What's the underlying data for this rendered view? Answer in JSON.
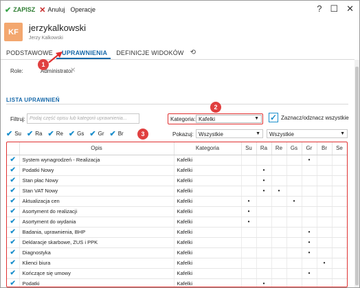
{
  "toolbar": {
    "save_label": "ZAPISZ",
    "cancel_label": "Anuluj",
    "operations_label": "Operacje",
    "help_glyph": "?",
    "maximize_glyph": "☐",
    "close_glyph": "✕"
  },
  "header": {
    "avatar_initials": "KF",
    "title": "jerzykalkowski",
    "subtitle": "Jerzy Kalkowski"
  },
  "tabs": [
    {
      "label": "PODSTAWOWE"
    },
    {
      "label": "UPRAWNIENIA"
    },
    {
      "label": "DEFINICJE WIDOKÓW"
    }
  ],
  "role": {
    "label": "Role:",
    "value": "Administrator"
  },
  "section": {
    "title": "LISTA UPRAWNIEŃ"
  },
  "filter": {
    "label": "Filtruj:",
    "placeholder": "Podaj część opisu lub kategorii uprawnienia..."
  },
  "category": {
    "label": "Kategoria:",
    "value": "Kafelki"
  },
  "toggle_all": {
    "label": "Zaznacz/odznacz wszystkie"
  },
  "column_filters": [
    "Su",
    "Ra",
    "Re",
    "Gs",
    "Gr",
    "Br"
  ],
  "pokazuj": {
    "label": "Pokazuj:",
    "value": "Wszystkie"
  },
  "second_select": {
    "value": "Wszystkie"
  },
  "badges": [
    "1",
    "2",
    "3"
  ],
  "table": {
    "headers": [
      "Opis",
      "Kategoria",
      "Su",
      "Ra",
      "Re",
      "Gs",
      "Gr",
      "Br",
      "Se"
    ],
    "rows": [
      {
        "opis": "System wynagrodzeń - Realizacja",
        "kategoria": "Kafelki",
        "flags": [
          "",
          "",
          "",
          "",
          "•",
          "",
          ""
        ]
      },
      {
        "opis": "Podatki Nowy",
        "kategoria": "Kafelki",
        "flags": [
          "",
          "•",
          "",
          "",
          "",
          "",
          ""
        ]
      },
      {
        "opis": "Stan płac Nowy",
        "kategoria": "Kafelki",
        "flags": [
          "",
          "•",
          "",
          "",
          "",
          "",
          ""
        ]
      },
      {
        "opis": "Stan VAT Nowy",
        "kategoria": "Kafelki",
        "flags": [
          "",
          "•",
          "•",
          "",
          "",
          "",
          ""
        ]
      },
      {
        "opis": "Aktualizacja cen",
        "kategoria": "Kafelki",
        "flags": [
          "•",
          "",
          "",
          "•",
          "",
          "",
          ""
        ]
      },
      {
        "opis": "Asortyment do realizacji",
        "kategoria": "Kafelki",
        "flags": [
          "•",
          "",
          "",
          "",
          "",
          "",
          ""
        ]
      },
      {
        "opis": "Asortyment do wydania",
        "kategoria": "Kafelki",
        "flags": [
          "•",
          "",
          "",
          "",
          "",
          "",
          ""
        ]
      },
      {
        "opis": "Badania, uprawnienia, BHP",
        "kategoria": "Kafelki",
        "flags": [
          "",
          "",
          "",
          "",
          "•",
          "",
          ""
        ]
      },
      {
        "opis": "Deklaracje skarbowe, ZUS i PPK",
        "kategoria": "Kafelki",
        "flags": [
          "",
          "",
          "",
          "",
          "•",
          "",
          ""
        ]
      },
      {
        "opis": "Diagnostyka",
        "kategoria": "Kafelki",
        "flags": [
          "",
          "",
          "",
          "",
          "•",
          "",
          ""
        ]
      },
      {
        "opis": "Klienci biura",
        "kategoria": "Kafelki",
        "flags": [
          "",
          "",
          "",
          "",
          "",
          "•",
          ""
        ]
      },
      {
        "opis": "Kończące się umowy",
        "kategoria": "Kafelki",
        "flags": [
          "",
          "",
          "",
          "",
          "•",
          "",
          ""
        ]
      },
      {
        "opis": "Podatki",
        "kategoria": "Kafelki",
        "flags": [
          "",
          "•",
          "",
          "",
          "",
          "",
          ""
        ]
      }
    ]
  },
  "colors": {
    "accent": "#1769aa",
    "check": "#1b8fcc",
    "highlight": "#e03030",
    "avatar": "#f3a76f"
  }
}
